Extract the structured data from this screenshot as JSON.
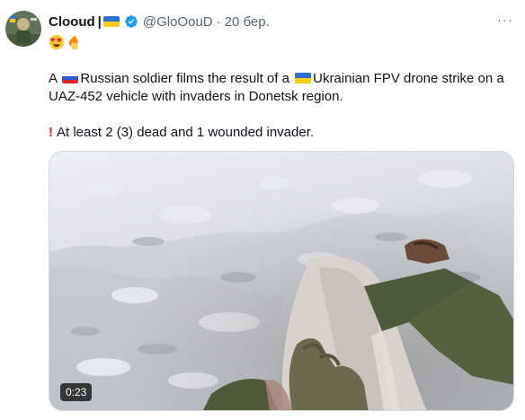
{
  "author": {
    "display_name": "Clooud",
    "separator": "|",
    "handle": "@GloOouD",
    "dot": "·",
    "date": "20 бер."
  },
  "emoji_line": [
    "heart-eyes-emoji",
    "fire-emoji"
  ],
  "tweet": {
    "line1_a": "A ",
    "line1_b": "Russian soldier films the result of a ",
    "line1_c": "Ukrainian FPV drone strike on a UAZ-452 vehicle with invaders in Donetsk region.",
    "line2": "At least 2 (3) dead and 1 wounded invader.",
    "excl": "!"
  },
  "media": {
    "duration": "0:23"
  },
  "more_label": "···",
  "colors": {
    "text": "#0f1419",
    "muted": "#536471",
    "verified": "#1d9bf0"
  }
}
